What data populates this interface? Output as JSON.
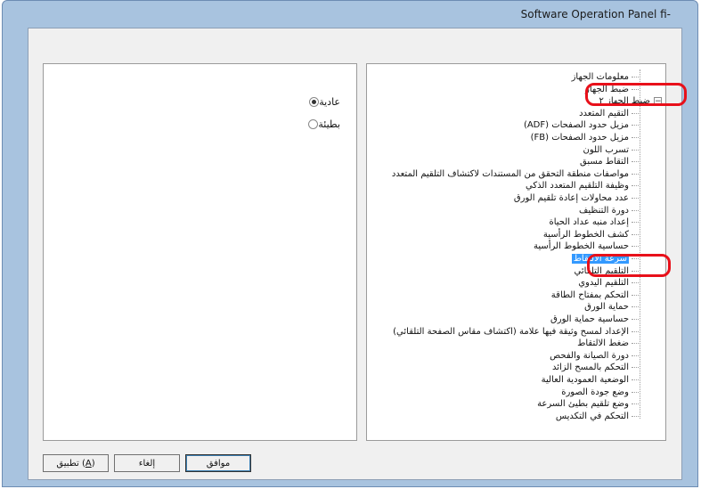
{
  "window": {
    "title": "Software Operation Panel fi-"
  },
  "left_panel": {
    "options": [
      {
        "label": "عادية",
        "checked": true
      },
      {
        "label": "بطيئة",
        "checked": false
      }
    ]
  },
  "tree": {
    "items": [
      {
        "label": "معلومات الجهاز"
      },
      {
        "label": "ضبط الجهاز"
      },
      {
        "label": "ضبط الجهاز ٢",
        "expander": "−"
      },
      {
        "label": "التقيم المتعدد"
      },
      {
        "label": "مزيل حدود الصفحات (ADF)"
      },
      {
        "label": "مزيل حدود الصفحات (FB)"
      },
      {
        "label": "تسرب اللون"
      },
      {
        "label": "التقاط مسبق"
      },
      {
        "label": "مواصفات منطقة التحقق من المستندات لاكتشاف التلقيم المتعدد"
      },
      {
        "label": "وظيفة التلقيم المتعدد الذكي"
      },
      {
        "label": "عدد محاولات إعادة تلقيم الورق"
      },
      {
        "label": "دورة التنظيف"
      },
      {
        "label": "إعداد منبه عداد الحياة"
      },
      {
        "label": "كشف الخطوط الرأسية"
      },
      {
        "label": "حساسية الخطوط الرأسية"
      },
      {
        "label": "سرعة الالتقاط",
        "selected": true
      },
      {
        "label": "التلقيم التلقائي"
      },
      {
        "label": "التلقيم اليدوي"
      },
      {
        "label": "التحكم بمفتاح الطاقة"
      },
      {
        "label": "حماية الورق"
      },
      {
        "label": "حساسية حماية الورق"
      },
      {
        "label": "الإعداد لمسح وثيقة فيها علامة (اكتشاف مقاس الصفحة التلقائي)"
      },
      {
        "label": "ضغط الالتقاط"
      },
      {
        "label": "دورة الصيانة والفحص"
      },
      {
        "label": "التحكم بالمسح الزائد"
      },
      {
        "label": "الوضعية العمودية العالية"
      },
      {
        "label": "وضع جودة الصورة"
      },
      {
        "label": "وضع تلقيم بطيئ السرعة"
      },
      {
        "label": "التحكم في التكديس"
      }
    ]
  },
  "buttons": {
    "apply": "تطبيق (A)",
    "apply_text": "تطبيق",
    "apply_key": "A",
    "cancel": "إلغاء",
    "ok": "موافق"
  },
  "colors": {
    "highlight": "#e8101a",
    "selection": "#3399ff",
    "frame": "#a8c3df"
  }
}
